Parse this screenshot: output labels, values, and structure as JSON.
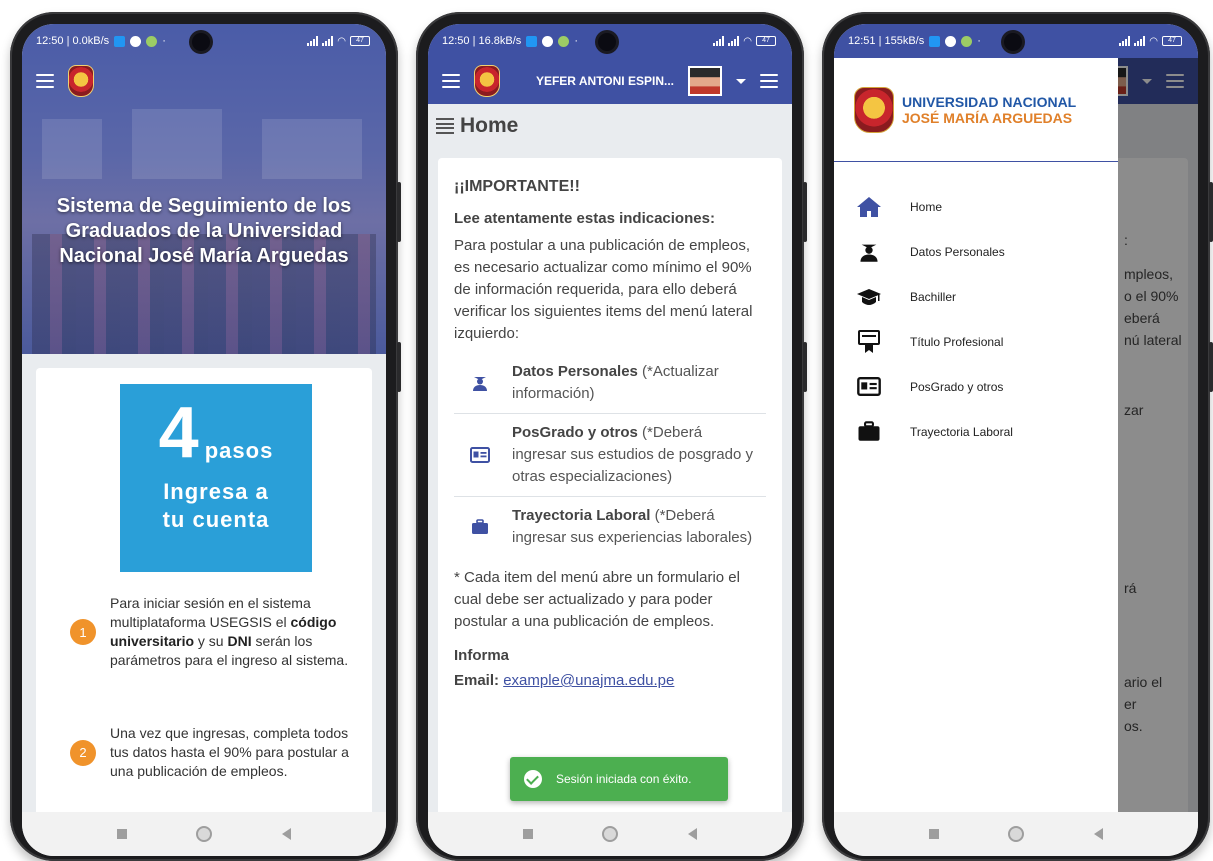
{
  "colors": {
    "primary": "#3f51a3",
    "step_badge": "#f0932b",
    "steps_box": "#2a9fd8",
    "toast": "#4caf50",
    "uni_blue": "#2157a6",
    "uni_orange": "#e0802a"
  },
  "phone1": {
    "status": {
      "time_speed": "12:50 | 0.0kB/s",
      "battery": "47"
    },
    "hero_title": "Sistema de Seguimiento de los Graduados de la Universidad Nacional José María Arguedas",
    "steps_box": {
      "number": "4",
      "pasos": "pasos",
      "line1": "Ingresa a",
      "line2": "tu cuenta"
    },
    "steps": [
      {
        "num": "1",
        "t1": "Para iniciar sesión en el sistema multiplataforma USEGSIS el ",
        "b1": "código universitario",
        "t2": " y su ",
        "b2": "DNI",
        "t3": " serán los parámetros para el ingreso al sistema."
      },
      {
        "num": "2",
        "text": "Una vez que ingresas, completa todos tus datos hasta el 90% para postular a una publicación de empleos."
      }
    ]
  },
  "phone2": {
    "status": {
      "time_speed": "12:50 | 16.8kB/s",
      "battery": "47"
    },
    "username": "YEFER ANTONI ESPIN...",
    "page_title": "Home",
    "important": "¡¡IMPORTANTE!!",
    "lee": "Lee atentamente estas indicaciones:",
    "intro": "Para postular a una publicación de empleos, es necesario actualizar como mínimo el 90% de información requerida, para ello deberá verificar los siguientes items del menú lateral izquierdo:",
    "items": [
      {
        "icon": "graduate-user-icon",
        "title": "Datos Personales",
        "note": " (*Actualizar información)"
      },
      {
        "icon": "id-card-icon",
        "title": "PosGrado y otros",
        "note": " (*Deberá ingresar sus estudios de posgrado y otras especializaciones)"
      },
      {
        "icon": "briefcase-icon",
        "title": "Trayectoria Laboral",
        "note": " (*Deberá ingresar sus experiencias laborales)"
      }
    ],
    "footnote": "* Cada item del menú abre un formulario el cual debe ser actualizado y para poder postular a una publicación de empleos.",
    "info_label": "Informa",
    "email_label": "Email:",
    "email_value": "example@unajma.edu.pe",
    "toast": "Sesión iniciada con éxito."
  },
  "phone3": {
    "status": {
      "time_speed": "12:51 | 155kB/s",
      "battery": "47"
    },
    "university_line1": "UNIVERSIDAD NACIONAL",
    "university_line2": "JOSÉ MARÍA ARGUEDAS",
    "menu": [
      {
        "icon": "home-icon",
        "label": "Home"
      },
      {
        "icon": "graduate-user-icon",
        "label": "Datos Personales"
      },
      {
        "icon": "graduation-cap-icon",
        "label": "Bachiller"
      },
      {
        "icon": "certificate-icon",
        "label": "Título Profesional"
      },
      {
        "icon": "id-card-icon",
        "label": "PosGrado y otros"
      },
      {
        "icon": "briefcase-icon",
        "label": "Trayectoria Laboral"
      }
    ],
    "bg_fragments": [
      ":",
      "mpleos,",
      "o el 90%",
      "eberá",
      "nú lateral",
      "zar",
      "rá",
      "ario el",
      "er",
      "os."
    ]
  }
}
